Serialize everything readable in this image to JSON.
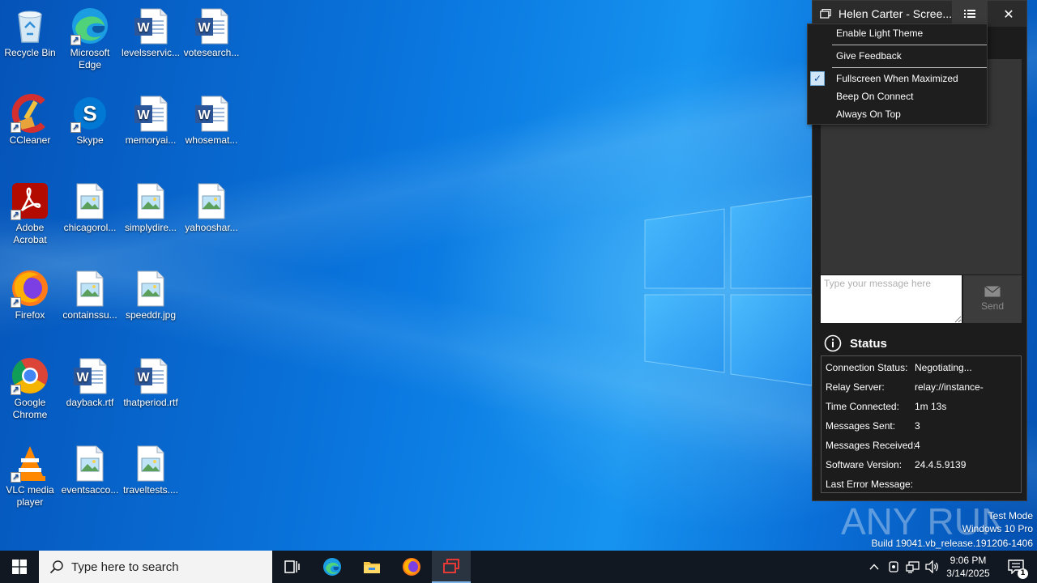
{
  "desktop": {
    "icons": [
      {
        "label": "Recycle Bin",
        "icon": "recycle-bin-icon"
      },
      {
        "label": "Microsoft Edge",
        "icon": "edge-icon"
      },
      {
        "label": "levelsservic...",
        "icon": "word-doc-icon"
      },
      {
        "label": "votesearch...",
        "icon": "word-doc-icon"
      },
      {
        "label": "CCleaner",
        "icon": "ccleaner-icon"
      },
      {
        "label": "Skype",
        "icon": "skype-icon"
      },
      {
        "label": "memoryai...",
        "icon": "word-doc-icon"
      },
      {
        "label": "whosemat...",
        "icon": "word-doc-icon"
      },
      {
        "label": "Adobe Acrobat",
        "icon": "acrobat-icon"
      },
      {
        "label": "chicagorol...",
        "icon": "image-file-icon"
      },
      {
        "label": "simplydire...",
        "icon": "image-file-icon"
      },
      {
        "label": "yahooshar...",
        "icon": "image-file-icon"
      },
      {
        "label": "Firefox",
        "icon": "firefox-icon"
      },
      {
        "label": "containssu...",
        "icon": "image-file-icon"
      },
      {
        "label": "speeddr.jpg",
        "icon": "image-file-icon"
      },
      {
        "label": "Google Chrome",
        "icon": "chrome-icon"
      },
      {
        "label": "dayback.rtf",
        "icon": "word-doc-icon"
      },
      {
        "label": "thatperiod.rtf",
        "icon": "word-doc-icon"
      },
      {
        "label": "VLC media player",
        "icon": "vlc-icon"
      },
      {
        "label": "eventsacco...",
        "icon": "image-file-icon"
      },
      {
        "label": "traveltests....",
        "icon": "image-file-icon"
      }
    ]
  },
  "remote_window": {
    "title": "Helen Carter - Scree...",
    "menu_items": [
      {
        "label": "Enable Light Theme",
        "checked": false
      },
      {
        "label": "Give Feedback",
        "checked": false
      },
      {
        "label": "Fullscreen When Maximized",
        "checked": true
      },
      {
        "label": "Beep On Connect",
        "checked": false
      },
      {
        "label": "Always On Top",
        "checked": false
      }
    ],
    "message_placeholder": "Type your message here",
    "send_label": "Send",
    "status_title": "Status",
    "status_rows": [
      {
        "key": "Connection Status:",
        "value": "Negotiating..."
      },
      {
        "key": "Relay Server:",
        "value": "relay://instance-"
      },
      {
        "key": "Time Connected:",
        "value": "1m 13s"
      },
      {
        "key": "Messages Sent:",
        "value": "3"
      },
      {
        "key": "Messages Received:",
        "value": "4"
      },
      {
        "key": "Software Version:",
        "value": "24.4.5.9139"
      },
      {
        "key": "Last Error Message:",
        "value": ""
      }
    ]
  },
  "watermark": {
    "brand": "ANY RUN",
    "line1": "Test Mode",
    "line2": "Windows 10 Pro",
    "line3": "Build 19041.vb_release.191206-1406"
  },
  "taskbar": {
    "search_placeholder": "Type here to search",
    "clock_time": "9:06 PM",
    "clock_date": "3/14/2025",
    "notification_count": "1",
    "apps": [
      "task-view-icon",
      "edge-icon",
      "file-explorer-icon",
      "firefox-icon",
      "remote-support-icon"
    ]
  },
  "colors": {
    "taskbar_bg": "#111821",
    "window_bg": "#1c1c1c",
    "accent": "#0a78e0"
  }
}
